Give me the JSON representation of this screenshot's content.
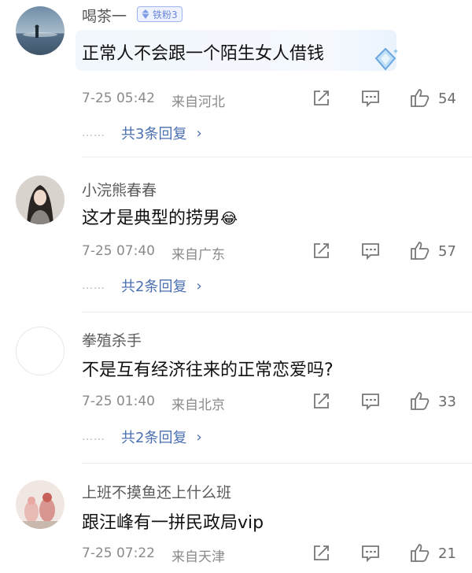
{
  "comments": [
    {
      "username": "喝茶一",
      "badge": "铁粉3",
      "text": "正常人不会跟一个陌生女人借钱",
      "time": "7-25 05:42",
      "location": "来自河北",
      "likes": "54",
      "replies": "共3条回复",
      "reply_dots": "……"
    },
    {
      "username": "小浣熊春春",
      "text": "这才是典型的捞男",
      "emoji": "😂",
      "time": "7-25 07:40",
      "location": "来自广东",
      "likes": "57",
      "replies": "共2条回复",
      "reply_dots": "……"
    },
    {
      "username": "拳殖杀手",
      "text": "不是互有经济往来的正常恋爱吗?",
      "time": "7-25 01:40",
      "location": "来自北京",
      "likes": "33",
      "replies": "共2条回复",
      "reply_dots": "……"
    },
    {
      "username": "上班不摸鱼还上什么班",
      "text": "跟汪峰有一拼民政局vip",
      "time": "7-25 07:22",
      "location": "来自天津",
      "likes": "21"
    }
  ],
  "icons": {
    "share": "share-icon",
    "comment": "comment-icon",
    "like": "thumbs-up-icon",
    "reply_chevron": "chevron-right-icon",
    "highlight": "diamond-icon"
  },
  "colors": {
    "link": "#4a6fb2",
    "badge": "#6a84d8",
    "meta": "#8a8a8a"
  }
}
